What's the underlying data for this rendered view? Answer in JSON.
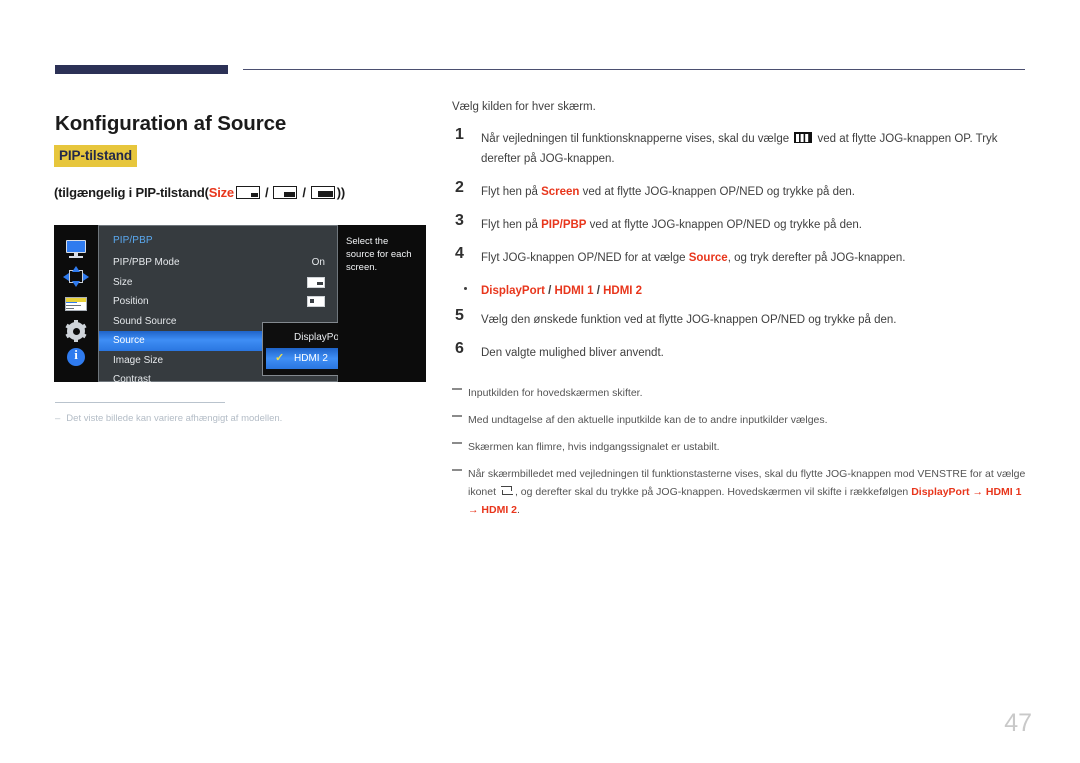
{
  "header": {
    "rule_color": "#2c3156"
  },
  "page": {
    "title": "Konfiguration af Source",
    "badge": "PIP-tilstand",
    "badge_bg": "#e7c63c",
    "availability": {
      "prefix": "(tilgængelig i PIP-tilstand(",
      "size_label": "Size",
      "sep": "/",
      "suffix": "))"
    },
    "number": "47"
  },
  "osd": {
    "icons": [
      {
        "name": "monitor-icon"
      },
      {
        "name": "pip-position-arrows-icon"
      },
      {
        "name": "onscreen-display-list-icon"
      },
      {
        "name": "system-gear-icon"
      },
      {
        "name": "information-icon"
      }
    ],
    "menu_header": "PIP/PBP",
    "rows": [
      {
        "label": "PIP/PBP Mode",
        "value": "On",
        "glyph": "",
        "selected": false
      },
      {
        "label": "Size",
        "value": "",
        "glyph": "size",
        "selected": false
      },
      {
        "label": "Position",
        "value": "",
        "glyph": "pos",
        "selected": false
      },
      {
        "label": "Sound Source",
        "value": "",
        "glyph": "",
        "selected": false
      },
      {
        "label": "Source",
        "value": "",
        "glyph": "",
        "selected": true
      },
      {
        "label": "Image Size",
        "value": "",
        "glyph": "",
        "selected": false
      },
      {
        "label": "Contrast",
        "value": "",
        "glyph": "",
        "selected": false
      }
    ],
    "submenu": [
      {
        "label": "DisplayPort",
        "selected": false,
        "check": ""
      },
      {
        "label": "HDMI 2",
        "selected": true,
        "check": "✓"
      }
    ],
    "help_text": "Select the source for each screen.",
    "footnote": "Det viste billede kan variere afhængigt af modellen.",
    "footnote_dash": "–"
  },
  "instructions": {
    "intro": "Vælg kilden for hver skærm.",
    "steps": [
      {
        "num": "1",
        "parts": [
          {
            "t": "Når vejledningen til funktionsknapperne vises, skal du vælge ",
            "style": "plain"
          },
          {
            "t": "menu-glyph",
            "style": "glyph"
          },
          {
            "t": " ved at flytte JOG-knappen OP. Tryk derefter på JOG-knappen.",
            "style": "plain"
          }
        ]
      },
      {
        "num": "2",
        "parts": [
          {
            "t": "Flyt hen på ",
            "style": "plain"
          },
          {
            "t": "Screen",
            "style": "red"
          },
          {
            "t": " ved at flytte JOG-knappen OP/NED og trykke på den.",
            "style": "plain"
          }
        ]
      },
      {
        "num": "3",
        "parts": [
          {
            "t": "Flyt hen på ",
            "style": "plain"
          },
          {
            "t": "PIP/PBP",
            "style": "red"
          },
          {
            "t": " ved at flytte JOG-knappen OP/NED og trykke på den.",
            "style": "plain"
          }
        ]
      },
      {
        "num": "4",
        "parts": [
          {
            "t": "Flyt JOG-knappen OP/NED for at vælge ",
            "style": "plain"
          },
          {
            "t": "Source",
            "style": "red"
          },
          {
            "t": ", og tryk derefter på JOG-knappen.",
            "style": "plain"
          }
        ]
      }
    ],
    "bullet": {
      "a": "DisplayPort",
      "sep1": " / ",
      "b": "HDMI 1",
      "sep2": " / ",
      "c": "HDMI 2"
    },
    "steps_after": [
      {
        "num": "5",
        "parts": [
          {
            "t": "Vælg den ønskede funktion ved at flytte JOG-knappen OP/NED og trykke på den.",
            "style": "plain"
          }
        ]
      },
      {
        "num": "6",
        "parts": [
          {
            "t": "Den valgte mulighed bliver anvendt.",
            "style": "plain"
          }
        ]
      }
    ]
  },
  "notes": [
    {
      "text": "Inputkilden for hovedskærmen skifter."
    },
    {
      "text": "Med undtagelse af den aktuelle inputkilde kan de to andre inputkilder vælges."
    },
    {
      "text": "Skærmen kan flimre, hvis indgangssignalet er ustabilt."
    },
    {
      "text_before": "Når skærmbilledet med vejledningen til funktionstasterne vises, skal du flytte JOG-knappen mod VENSTRE for at vælge ikonet ",
      "text_middle": ", og derefter skal du trykke på JOG-knappen. Hovedskærmen vil skifte i rækkefølgen ",
      "red_a": "DisplayPort",
      "arrow1": " → ",
      "red_b": "HDMI 1",
      "arrow2": " → ",
      "red_c": "HDMI 2",
      "text_end": "."
    }
  ],
  "colors": {
    "accent_red": "#e8361c",
    "navy": "#2c3156",
    "highlight_yellow": "#e7c63c",
    "osd_blue": "#3f8ef5"
  }
}
